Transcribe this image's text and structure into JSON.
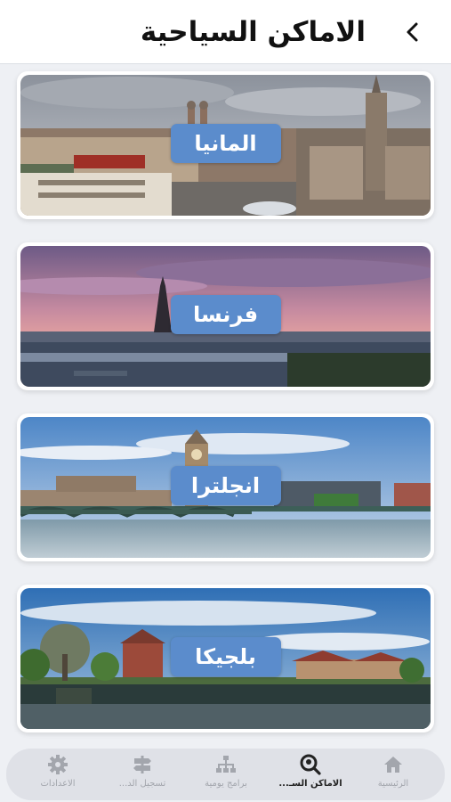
{
  "header": {
    "title": "الاماكن السياحية",
    "back_icon": "chevron-left-icon"
  },
  "destinations": [
    {
      "label": "المانيا"
    },
    {
      "label": "فرنسا"
    },
    {
      "label": "انجلترا"
    },
    {
      "label": "بلجيكا"
    }
  ],
  "tabbar": {
    "tabs": [
      {
        "label": "الرئيسية",
        "icon": "home-icon",
        "active": false
      },
      {
        "label": "الاماكن السـ...",
        "icon": "place-search-icon",
        "active": true
      },
      {
        "label": "برامج يومية",
        "icon": "sitemap-icon",
        "active": false
      },
      {
        "label": "تسجيل الد...",
        "icon": "signpost-icon",
        "active": false
      },
      {
        "label": "الاعدادات",
        "icon": "gear-icon",
        "active": false
      }
    ]
  },
  "colors": {
    "label_bg": "#5b8ccc",
    "tab_active": "#222222",
    "tab_inactive": "#a3a6ad"
  }
}
